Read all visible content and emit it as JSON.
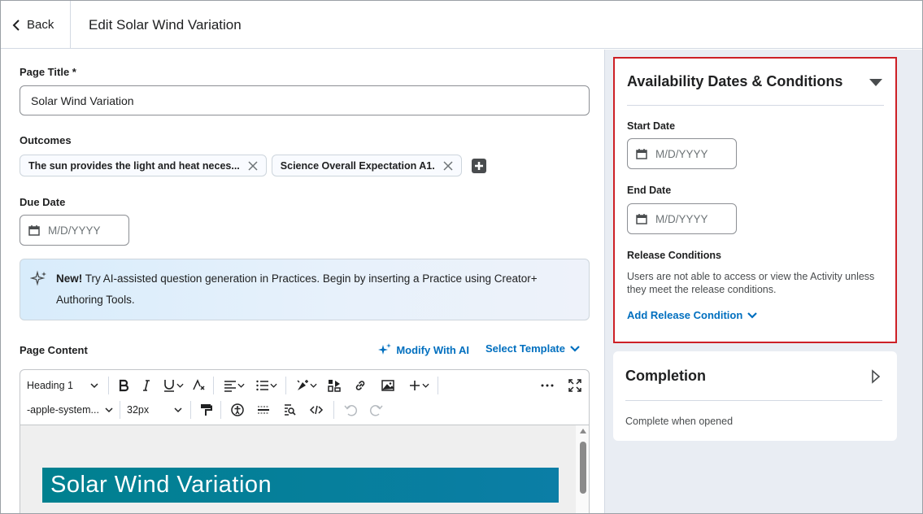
{
  "header": {
    "back_label": "Back",
    "title": "Edit Solar Wind Variation"
  },
  "form": {
    "page_title_label": "Page Title *",
    "page_title_value": "Solar Wind Variation",
    "outcomes_label": "Outcomes",
    "outcomes": [
      {
        "label": "The sun provides the light and heat neces..."
      },
      {
        "label": "Science Overall Expectation A1."
      }
    ],
    "due_date_label": "Due Date",
    "due_date_placeholder": "M/D/YYYY"
  },
  "ai_banner": {
    "new_label": "New!",
    "text": " Try AI-assisted question generation in Practices. Begin by inserting a Practice using Creator+ Authoring Tools."
  },
  "content": {
    "label": "Page Content",
    "modify_ai_label": "Modify With AI",
    "select_template_label": "Select Template",
    "toolbar": {
      "block_format": "Heading 1",
      "font_family": "-apple-system...",
      "font_size": "32px"
    },
    "heading_text": "Solar Wind Variation"
  },
  "availability": {
    "title": "Availability Dates & Conditions",
    "start_date_label": "Start Date",
    "start_date_placeholder": "M/D/YYYY",
    "end_date_label": "End Date",
    "end_date_placeholder": "M/D/YYYY",
    "release_conditions_label": "Release Conditions",
    "release_conditions_help": "Users are not able to access or view the Activity unless they meet the release conditions.",
    "add_release_label": "Add Release Condition"
  },
  "completion": {
    "title": "Completion",
    "value": "Complete when opened"
  },
  "colors": {
    "link": "#006fbf",
    "highlight_border": "#cd2026",
    "heading_banner": "#00808f"
  }
}
